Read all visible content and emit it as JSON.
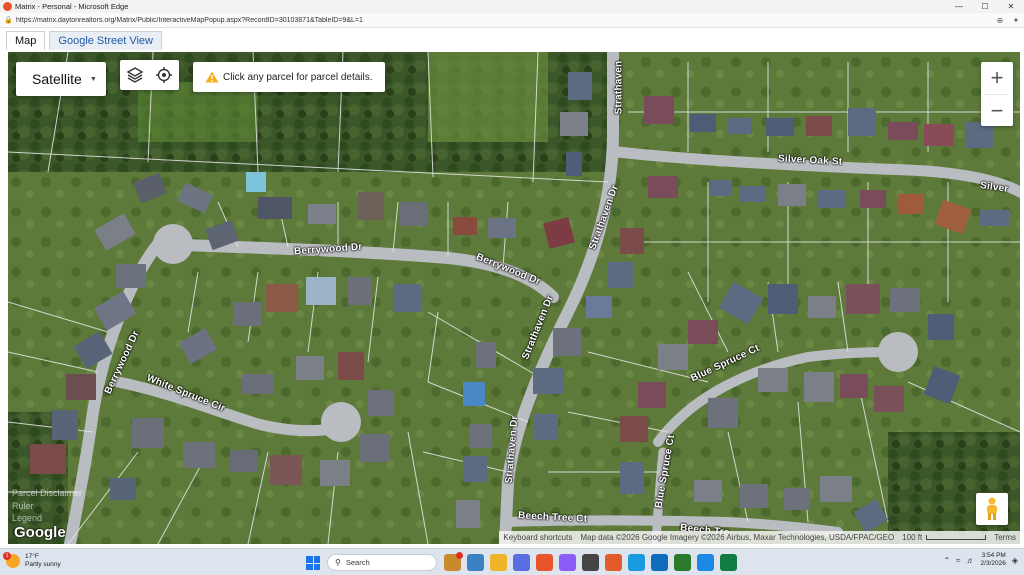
{
  "window": {
    "title": "Matrix - Personal - Microsoft Edge",
    "url": "https://matrix.daytonrealtors.org/Matrix/Public/InteractiveMapPopup.aspx?RecordID=30103871&TableID=9&L=1"
  },
  "tabs": [
    {
      "label": "Map",
      "active": true
    },
    {
      "label": "Google Street View",
      "active": false
    }
  ],
  "map": {
    "map_type": "Satellite",
    "notice": "Click any parcel for parcel details.",
    "zoom_in": "+",
    "zoom_out": "−",
    "road_labels": {
      "berrywood_top": "Berrywood Dr",
      "berrywood_curve": "Berrywood Dr",
      "berrywood_left": "Berrywood Dr",
      "white_spruce": "White Spruce Cir",
      "strathaven_top": "Strathaven",
      "strathaven_mid1": "Strathaven Dr",
      "strathaven_mid2": "Strathaven Dr",
      "strathaven_bottom": "Strathaven Dr",
      "silver_oak": "Silver Oak St",
      "silver_right": "Silver",
      "blue_spruce_ct": "Blue Spruce Ct",
      "blue_spruce_ct2": "Blue Spruce Ct",
      "beech_tree": "Beech Tree Ct",
      "beech_right": "Beech Tre"
    },
    "ghost_text": [
      "Parcel Disclaimer",
      "Ruler",
      "Legend"
    ],
    "google_logo": "Google",
    "attribution": {
      "shortcuts": "Keyboard shortcuts",
      "data": "Map data ©2026 Google Imagery ©2026 Airbus, Maxar Technologies, USDA/FPAC/GEO",
      "scale": "100 ft",
      "terms": "Terms"
    }
  },
  "taskbar": {
    "weather_temp": "17°F",
    "weather_desc": "Partly sunny",
    "weather_badge": "1",
    "search_placeholder": "Search",
    "time": "3:54 PM",
    "date": "2/3/2026",
    "app_colors": [
      "#c98a2e",
      "#3b82c4",
      "#f0b429",
      "#5b6ee1",
      "#e8542b",
      "#8b5cf6",
      "#444",
      "#e35b2a",
      "#1a9be0",
      "#0f6cbd",
      "#2b7a2b",
      "#1e88e5",
      "#107c41"
    ]
  }
}
